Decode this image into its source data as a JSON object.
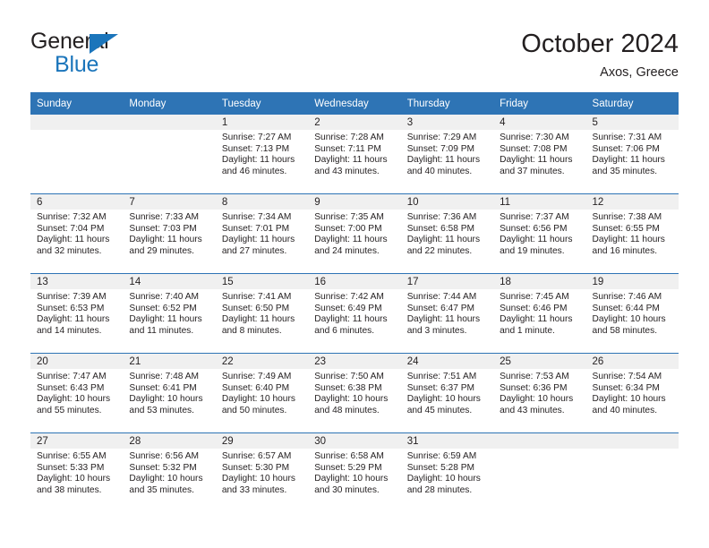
{
  "logo": {
    "word_one": "General",
    "word_two": "Blue"
  },
  "header": {
    "title": "October 2024",
    "location": "Axos, Greece"
  },
  "calendar": {
    "weekday_headers": [
      "Sunday",
      "Monday",
      "Tuesday",
      "Wednesday",
      "Thursday",
      "Friday",
      "Saturday"
    ],
    "colors": {
      "header_blue": "#2e74b5",
      "day_strip_gray": "#f0f0f0",
      "logo_blue": "#1b75bb",
      "text": "#231f20"
    },
    "weeks": [
      [
        {
          "day": "",
          "empty": true
        },
        {
          "day": "",
          "empty": true
        },
        {
          "day": "1",
          "sunrise": "Sunrise: 7:27 AM",
          "sunset": "Sunset: 7:13 PM",
          "daylight_line1": "Daylight: 11 hours",
          "daylight_line2": "and 46 minutes."
        },
        {
          "day": "2",
          "sunrise": "Sunrise: 7:28 AM",
          "sunset": "Sunset: 7:11 PM",
          "daylight_line1": "Daylight: 11 hours",
          "daylight_line2": "and 43 minutes."
        },
        {
          "day": "3",
          "sunrise": "Sunrise: 7:29 AM",
          "sunset": "Sunset: 7:09 PM",
          "daylight_line1": "Daylight: 11 hours",
          "daylight_line2": "and 40 minutes."
        },
        {
          "day": "4",
          "sunrise": "Sunrise: 7:30 AM",
          "sunset": "Sunset: 7:08 PM",
          "daylight_line1": "Daylight: 11 hours",
          "daylight_line2": "and 37 minutes."
        },
        {
          "day": "5",
          "sunrise": "Sunrise: 7:31 AM",
          "sunset": "Sunset: 7:06 PM",
          "daylight_line1": "Daylight: 11 hours",
          "daylight_line2": "and 35 minutes."
        }
      ],
      [
        {
          "day": "6",
          "sunrise": "Sunrise: 7:32 AM",
          "sunset": "Sunset: 7:04 PM",
          "daylight_line1": "Daylight: 11 hours",
          "daylight_line2": "and 32 minutes."
        },
        {
          "day": "7",
          "sunrise": "Sunrise: 7:33 AM",
          "sunset": "Sunset: 7:03 PM",
          "daylight_line1": "Daylight: 11 hours",
          "daylight_line2": "and 29 minutes."
        },
        {
          "day": "8",
          "sunrise": "Sunrise: 7:34 AM",
          "sunset": "Sunset: 7:01 PM",
          "daylight_line1": "Daylight: 11 hours",
          "daylight_line2": "and 27 minutes."
        },
        {
          "day": "9",
          "sunrise": "Sunrise: 7:35 AM",
          "sunset": "Sunset: 7:00 PM",
          "daylight_line1": "Daylight: 11 hours",
          "daylight_line2": "and 24 minutes."
        },
        {
          "day": "10",
          "sunrise": "Sunrise: 7:36 AM",
          "sunset": "Sunset: 6:58 PM",
          "daylight_line1": "Daylight: 11 hours",
          "daylight_line2": "and 22 minutes."
        },
        {
          "day": "11",
          "sunrise": "Sunrise: 7:37 AM",
          "sunset": "Sunset: 6:56 PM",
          "daylight_line1": "Daylight: 11 hours",
          "daylight_line2": "and 19 minutes."
        },
        {
          "day": "12",
          "sunrise": "Sunrise: 7:38 AM",
          "sunset": "Sunset: 6:55 PM",
          "daylight_line1": "Daylight: 11 hours",
          "daylight_line2": "and 16 minutes."
        }
      ],
      [
        {
          "day": "13",
          "sunrise": "Sunrise: 7:39 AM",
          "sunset": "Sunset: 6:53 PM",
          "daylight_line1": "Daylight: 11 hours",
          "daylight_line2": "and 14 minutes."
        },
        {
          "day": "14",
          "sunrise": "Sunrise: 7:40 AM",
          "sunset": "Sunset: 6:52 PM",
          "daylight_line1": "Daylight: 11 hours",
          "daylight_line2": "and 11 minutes."
        },
        {
          "day": "15",
          "sunrise": "Sunrise: 7:41 AM",
          "sunset": "Sunset: 6:50 PM",
          "daylight_line1": "Daylight: 11 hours",
          "daylight_line2": "and 8 minutes."
        },
        {
          "day": "16",
          "sunrise": "Sunrise: 7:42 AM",
          "sunset": "Sunset: 6:49 PM",
          "daylight_line1": "Daylight: 11 hours",
          "daylight_line2": "and 6 minutes."
        },
        {
          "day": "17",
          "sunrise": "Sunrise: 7:44 AM",
          "sunset": "Sunset: 6:47 PM",
          "daylight_line1": "Daylight: 11 hours",
          "daylight_line2": "and 3 minutes."
        },
        {
          "day": "18",
          "sunrise": "Sunrise: 7:45 AM",
          "sunset": "Sunset: 6:46 PM",
          "daylight_line1": "Daylight: 11 hours",
          "daylight_line2": "and 1 minute."
        },
        {
          "day": "19",
          "sunrise": "Sunrise: 7:46 AM",
          "sunset": "Sunset: 6:44 PM",
          "daylight_line1": "Daylight: 10 hours",
          "daylight_line2": "and 58 minutes."
        }
      ],
      [
        {
          "day": "20",
          "sunrise": "Sunrise: 7:47 AM",
          "sunset": "Sunset: 6:43 PM",
          "daylight_line1": "Daylight: 10 hours",
          "daylight_line2": "and 55 minutes."
        },
        {
          "day": "21",
          "sunrise": "Sunrise: 7:48 AM",
          "sunset": "Sunset: 6:41 PM",
          "daylight_line1": "Daylight: 10 hours",
          "daylight_line2": "and 53 minutes."
        },
        {
          "day": "22",
          "sunrise": "Sunrise: 7:49 AM",
          "sunset": "Sunset: 6:40 PM",
          "daylight_line1": "Daylight: 10 hours",
          "daylight_line2": "and 50 minutes."
        },
        {
          "day": "23",
          "sunrise": "Sunrise: 7:50 AM",
          "sunset": "Sunset: 6:38 PM",
          "daylight_line1": "Daylight: 10 hours",
          "daylight_line2": "and 48 minutes."
        },
        {
          "day": "24",
          "sunrise": "Sunrise: 7:51 AM",
          "sunset": "Sunset: 6:37 PM",
          "daylight_line1": "Daylight: 10 hours",
          "daylight_line2": "and 45 minutes."
        },
        {
          "day": "25",
          "sunrise": "Sunrise: 7:53 AM",
          "sunset": "Sunset: 6:36 PM",
          "daylight_line1": "Daylight: 10 hours",
          "daylight_line2": "and 43 minutes."
        },
        {
          "day": "26",
          "sunrise": "Sunrise: 7:54 AM",
          "sunset": "Sunset: 6:34 PM",
          "daylight_line1": "Daylight: 10 hours",
          "daylight_line2": "and 40 minutes."
        }
      ],
      [
        {
          "day": "27",
          "sunrise": "Sunrise: 6:55 AM",
          "sunset": "Sunset: 5:33 PM",
          "daylight_line1": "Daylight: 10 hours",
          "daylight_line2": "and 38 minutes."
        },
        {
          "day": "28",
          "sunrise": "Sunrise: 6:56 AM",
          "sunset": "Sunset: 5:32 PM",
          "daylight_line1": "Daylight: 10 hours",
          "daylight_line2": "and 35 minutes."
        },
        {
          "day": "29",
          "sunrise": "Sunrise: 6:57 AM",
          "sunset": "Sunset: 5:30 PM",
          "daylight_line1": "Daylight: 10 hours",
          "daylight_line2": "and 33 minutes."
        },
        {
          "day": "30",
          "sunrise": "Sunrise: 6:58 AM",
          "sunset": "Sunset: 5:29 PM",
          "daylight_line1": "Daylight: 10 hours",
          "daylight_line2": "and 30 minutes."
        },
        {
          "day": "31",
          "sunrise": "Sunrise: 6:59 AM",
          "sunset": "Sunset: 5:28 PM",
          "daylight_line1": "Daylight: 10 hours",
          "daylight_line2": "and 28 minutes."
        },
        {
          "day": "",
          "empty": true
        },
        {
          "day": "",
          "empty": true
        }
      ]
    ]
  }
}
